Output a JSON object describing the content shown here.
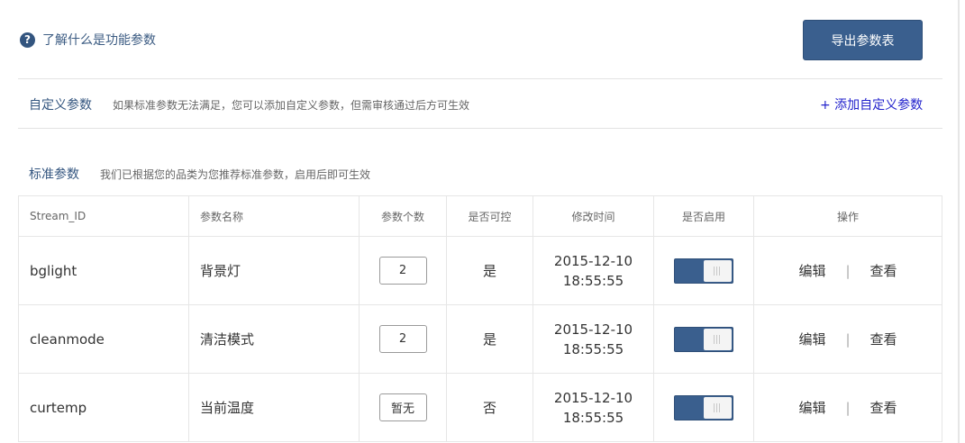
{
  "help": {
    "icon": "question-circle-icon",
    "label": "了解什么是功能参数"
  },
  "toolbar": {
    "export_label": "导出参数表"
  },
  "custom_section": {
    "label": "自定义参数",
    "description": "如果标准参数无法满足，您可以添加自定义参数，但需审核通过后方可生效",
    "add_link": "+ 添加自定义参数"
  },
  "standard_section": {
    "label": "标准参数",
    "description": "我们已根据您的品类为您推荐标准参数，启用后即可生效"
  },
  "table": {
    "headers": [
      "Stream_ID",
      "参数名称",
      "参数个数",
      "是否可控",
      "修改时间",
      "是否启用",
      "操作"
    ],
    "rows": [
      {
        "stream_id": "bglight",
        "name": "背景灯",
        "count": "2",
        "controllable": "是",
        "date": "2015-12-10",
        "time": "18:55:55",
        "enabled": true,
        "edit": "编辑",
        "sep": "|",
        "view": "查看"
      },
      {
        "stream_id": "cleanmode",
        "name": "清洁模式",
        "count": "2",
        "controllable": "是",
        "date": "2015-12-10",
        "time": "18:55:55",
        "enabled": true,
        "edit": "编辑",
        "sep": "|",
        "view": "查看"
      },
      {
        "stream_id": "curtemp",
        "name": "当前温度",
        "count": "暂无",
        "controllable": "否",
        "date": "2015-12-10",
        "time": "18:55:55",
        "enabled": true,
        "edit": "编辑",
        "sep": "|",
        "view": "查看"
      }
    ]
  },
  "colors": {
    "accent": "#3a5f8e",
    "link": "#2222cc",
    "label": "#33557f"
  }
}
